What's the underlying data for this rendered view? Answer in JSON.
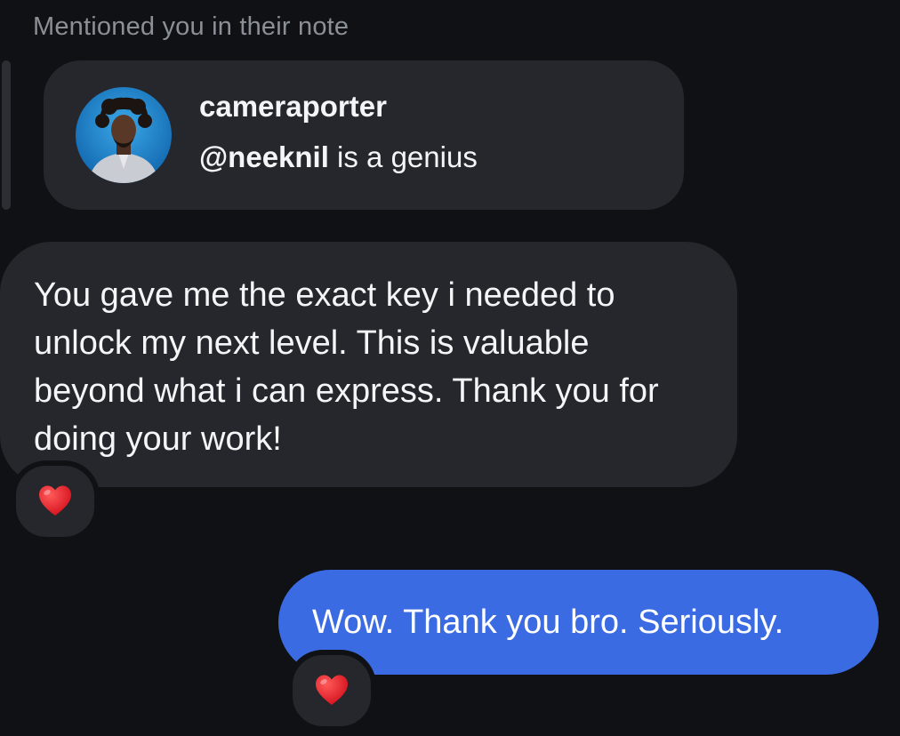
{
  "context_label": "Mentioned you in their note",
  "note": {
    "author": "cameraporter",
    "mention": "@neeknil",
    "text_rest": " is a genius"
  },
  "messages": {
    "incoming": {
      "text": "You gave me the exact key i needed to unlock my next level. This is valuable beyond what i can express. Thank you for doing your work!",
      "reaction": "heart-emoji"
    },
    "outgoing": {
      "text": "Wow. Thank you bro. Seriously.",
      "reaction": "heart-emoji"
    }
  },
  "colors": {
    "background": "#0f1115",
    "bubble_incoming": "#25272c",
    "bubble_outgoing": "#3b6be3",
    "heart": "#e8202a"
  }
}
